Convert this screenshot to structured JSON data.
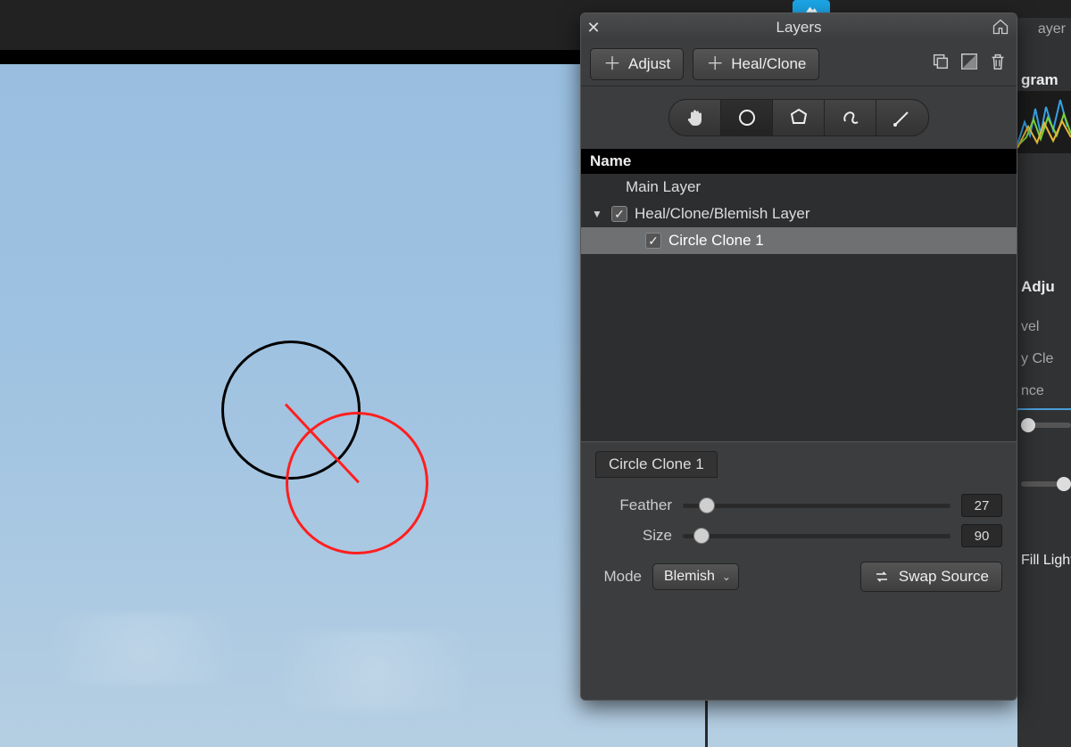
{
  "panel": {
    "title": "Layers",
    "adjust_btn": "Adjust",
    "healclone_btn": "Heal/Clone",
    "list_header": "Name",
    "layers": {
      "main": "Main Layer",
      "heal": "Heal/Clone/Blemish Layer",
      "circle": "Circle Clone 1"
    }
  },
  "properties": {
    "title": "Circle Clone 1",
    "feather_label": "Feather",
    "feather_value": "27",
    "size_label": "Size",
    "size_value": "90",
    "mode_label": "Mode",
    "mode_value": "Blemish",
    "swap_btn": "Swap Source"
  },
  "rightbar": {
    "tab": "ayer",
    "histogram": "gram",
    "adjust": "Adju",
    "items": {
      "a": "vel",
      "b": "y Cle",
      "c": "nce"
    },
    "fill_light": "Fill Light"
  }
}
